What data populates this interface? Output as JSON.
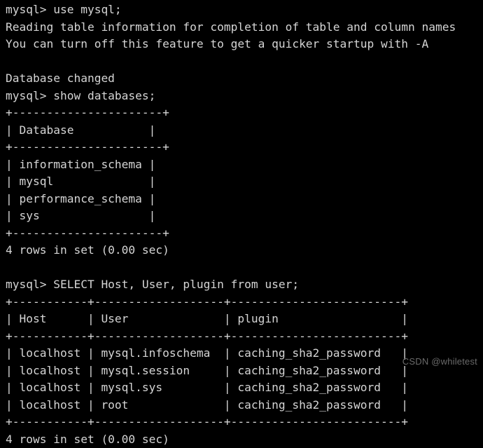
{
  "terminal": {
    "app": "mysql-client-terminal",
    "background_color": "#000000",
    "text_color": "#d5d5d5",
    "prompt": "mysql>",
    "lines": [
      {
        "name": "command-use-mysql",
        "text": "mysql> use mysql;"
      },
      {
        "name": "notice-reading-table-info",
        "text": "Reading table information for completion of table and column names"
      },
      {
        "name": "notice-turn-off-feature",
        "text": "You can turn off this feature to get a quicker startup with -A"
      },
      {
        "name": "blank-line",
        "text": ""
      },
      {
        "name": "status-database-changed",
        "text": "Database changed"
      },
      {
        "name": "command-show-databases",
        "text": "mysql> show databases;"
      },
      {
        "name": "databases-table-top-border",
        "text": "+----------------------+"
      },
      {
        "name": "databases-table-header-row",
        "text": "| Database           |"
      },
      {
        "name": "databases-table-header-sep",
        "text": "+----------------------+"
      },
      {
        "name": "databases-table-row-1",
        "text": "| information_schema |"
      },
      {
        "name": "databases-table-row-2",
        "text": "| mysql              |"
      },
      {
        "name": "databases-table-row-3",
        "text": "| performance_schema |"
      },
      {
        "name": "databases-table-row-4",
        "text": "| sys                |"
      },
      {
        "name": "databases-table-bottom-border",
        "text": "+----------------------+"
      },
      {
        "name": "databases-result-count",
        "text": "4 rows in set (0.00 sec)"
      },
      {
        "name": "blank-line",
        "text": ""
      },
      {
        "name": "command-select-users",
        "text": "mysql> SELECT Host, User, plugin from user;"
      },
      {
        "name": "users-table-top-border",
        "text": "+-----------+-------------------+-------------------------+"
      },
      {
        "name": "users-table-header-row",
        "text": "| Host      | User              | plugin                  |"
      },
      {
        "name": "users-table-header-sep",
        "text": "+-----------+-------------------+-------------------------+"
      },
      {
        "name": "users-table-row-1",
        "text": "| localhost | mysql.infoschema  | caching_sha2_password   |"
      },
      {
        "name": "users-table-row-2",
        "text": "| localhost | mysql.session     | caching_sha2_password   |"
      },
      {
        "name": "users-table-row-3",
        "text": "| localhost | mysql.sys         | caching_sha2_password   |"
      },
      {
        "name": "users-table-row-4",
        "text": "| localhost | root              | caching_sha2_password   |"
      },
      {
        "name": "users-table-bottom-border",
        "text": "+-----------+-------------------+-------------------------+"
      },
      {
        "name": "users-result-count",
        "text": "4 rows in set (0.00 sec)"
      }
    ],
    "databases_result": {
      "columns": [
        "Database"
      ],
      "rows": [
        [
          "information_schema"
        ],
        [
          "mysql"
        ],
        [
          "performance_schema"
        ],
        [
          "sys"
        ]
      ],
      "row_count_text": "4 rows in set (0.00 sec)"
    },
    "users_result": {
      "columns": [
        "Host",
        "User",
        "plugin"
      ],
      "rows": [
        [
          "localhost",
          "mysql.infoschema",
          "caching_sha2_password"
        ],
        [
          "localhost",
          "mysql.session",
          "caching_sha2_password"
        ],
        [
          "localhost",
          "mysql.sys",
          "caching_sha2_password"
        ],
        [
          "localhost",
          "root",
          "caching_sha2_password"
        ]
      ],
      "row_count_text": "4 rows in set (0.00 sec)"
    }
  },
  "watermark": {
    "text": "CSDN @whiletest",
    "color": "#6a6a6a"
  }
}
